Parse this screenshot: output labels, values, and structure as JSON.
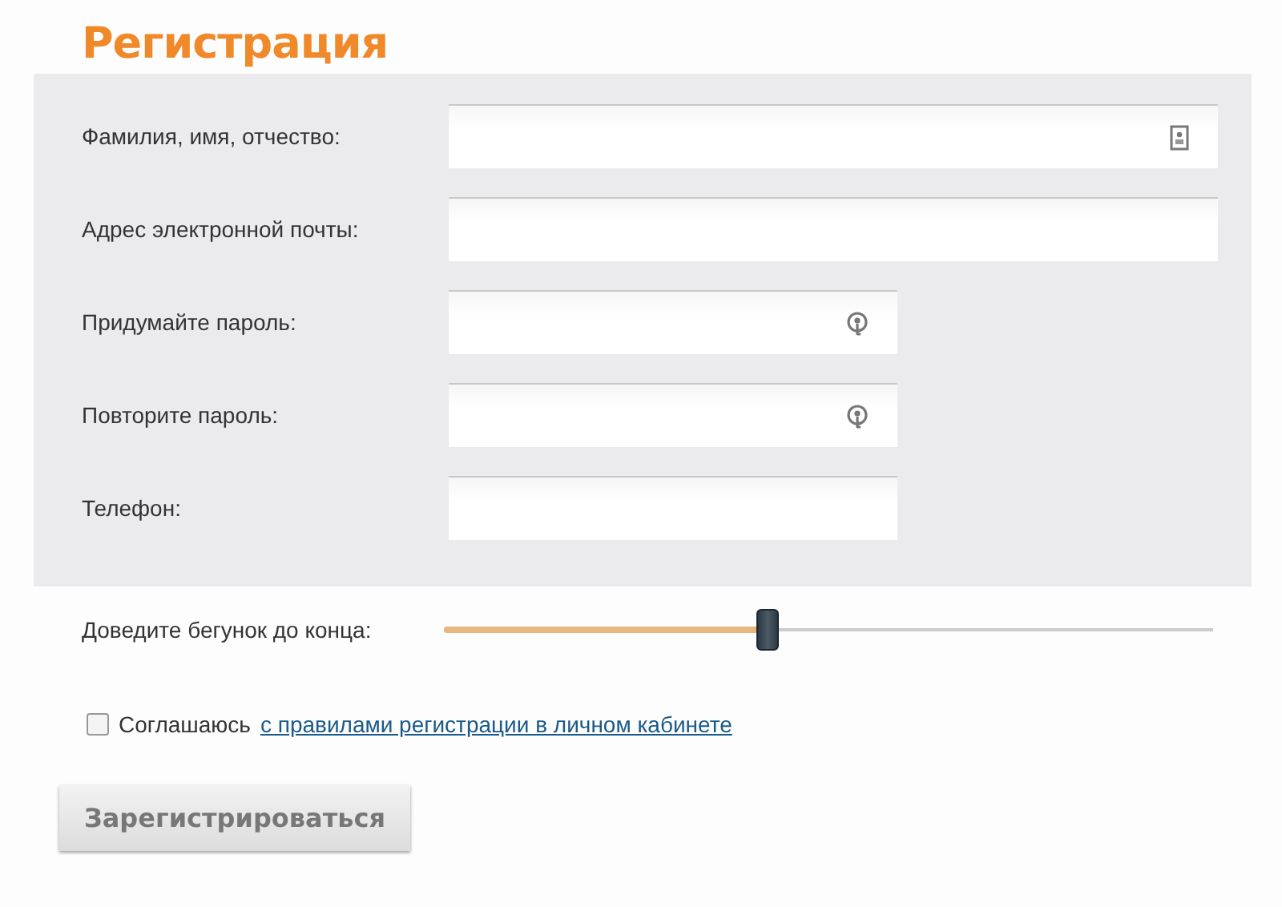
{
  "title": "Регистрация",
  "fields": [
    {
      "label": "Фамилия, имя, отчество:",
      "kind": "name"
    },
    {
      "label": "Адрес электронной почты:",
      "kind": "email"
    },
    {
      "label": "Придумайте пароль:",
      "kind": "password"
    },
    {
      "label": "Повторите пароль:",
      "kind": "password"
    },
    {
      "label": "Телефон:",
      "kind": "phone"
    }
  ],
  "slider": {
    "label": "Доведите бегунок до конца:",
    "level": 0.42
  },
  "agreement": {
    "checked": false,
    "text": "Соглашаюсь",
    "link": "с правилами регистрации в личном кабинете"
  },
  "submit": {
    "label": "Зарегистрироваться",
    "disabled": true
  }
}
